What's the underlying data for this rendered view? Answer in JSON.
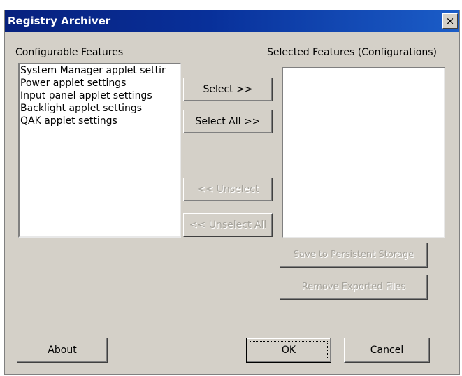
{
  "window": {
    "title": "Registry Archiver",
    "close_glyph": "×"
  },
  "labels": {
    "configurable": "Configurable Features",
    "selected": "Selected Features (Configurations)"
  },
  "configurable_list": [
    "System Manager applet settir",
    "Power applet settings",
    "Input panel applet settings",
    "Backlight applet settings",
    "QAK applet settings"
  ],
  "selected_list": [],
  "buttons": {
    "select": "Select >>",
    "select_all": "Select All >>",
    "unselect": "<< Unselect",
    "unselect_all": "<< Unselect All",
    "save_persistent": "Save to Persistent Storage",
    "remove_exported": "Remove Exported Files",
    "about": "About",
    "ok": "OK",
    "cancel": "Cancel"
  }
}
